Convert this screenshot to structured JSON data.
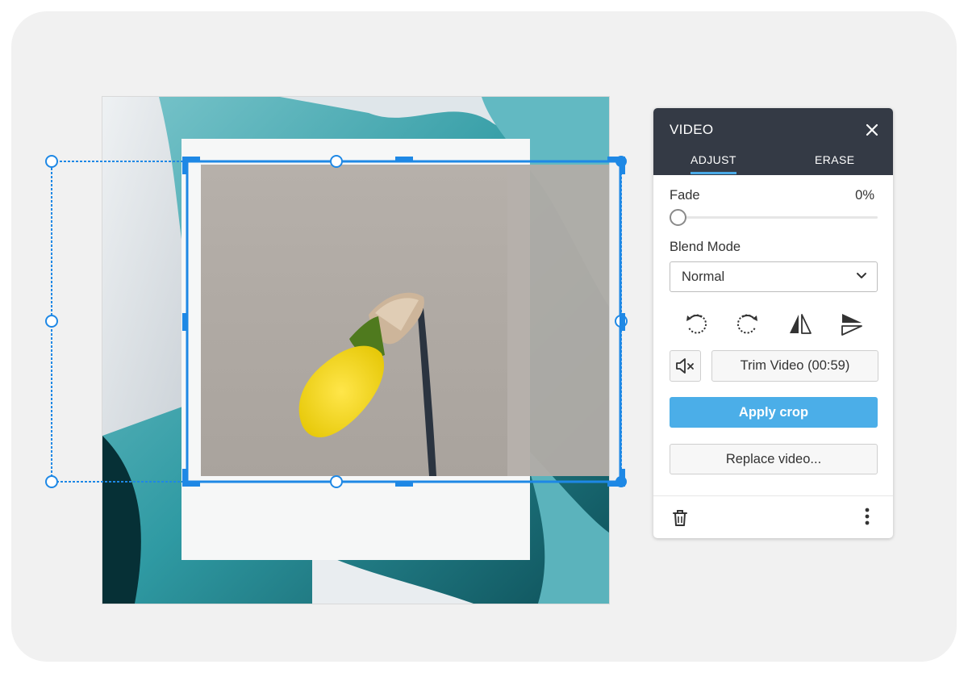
{
  "panel": {
    "title": "VIDEO",
    "tabs": [
      {
        "label": "ADJUST",
        "active": true
      },
      {
        "label": "ERASE",
        "active": false
      }
    ],
    "fade": {
      "label": "Fade",
      "value": "0%",
      "level": 0
    },
    "blend_mode": {
      "label": "Blend Mode",
      "selected": "Normal"
    },
    "tools": [
      "rotate-left-icon",
      "rotate-right-icon",
      "flip-horizontal-icon",
      "flip-vertical-icon"
    ],
    "mute_icon": "speaker-muted-icon",
    "trim_label": "Trim Video (00:59)",
    "apply_label": "Apply crop",
    "replace_label": "Replace video...",
    "footer_icons": [
      "trash-icon",
      "more-vertical-icon"
    ]
  },
  "colors": {
    "accent": "#4baee8",
    "crop_handle": "#1e88e5",
    "panel_header": "#343a45",
    "stage_background": "#f1f1f1"
  }
}
